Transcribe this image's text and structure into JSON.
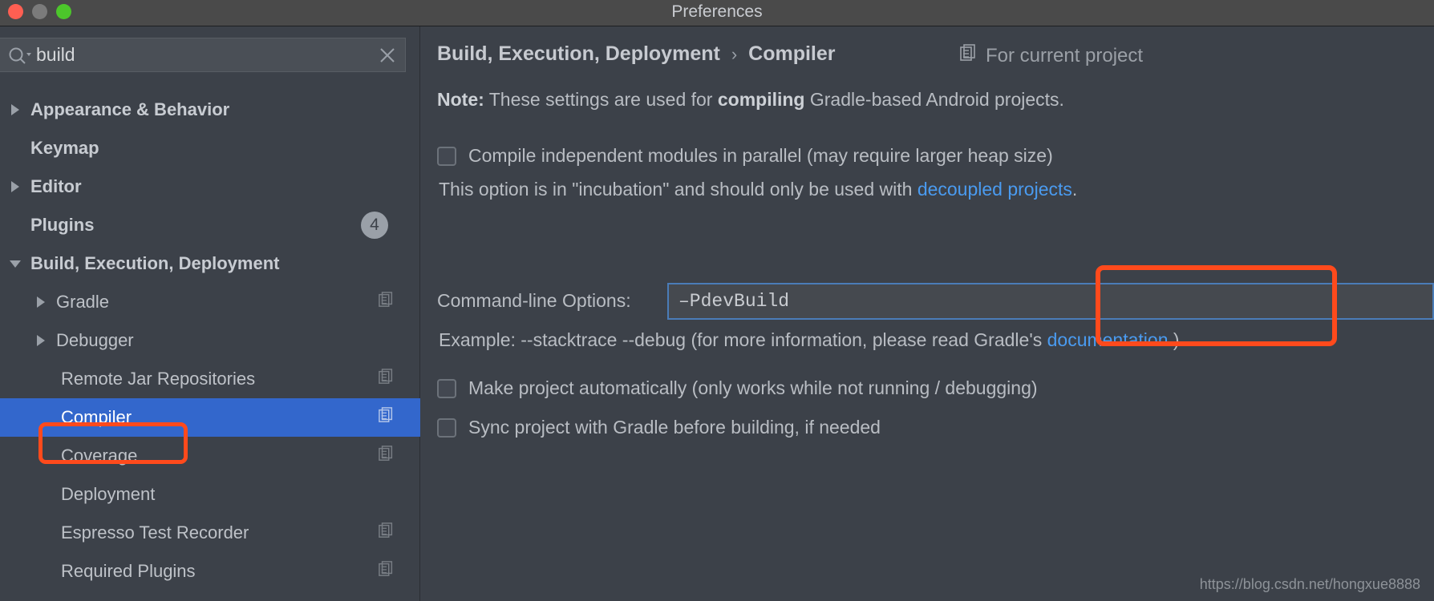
{
  "window": {
    "title": "Preferences",
    "traffic_lights": [
      "close-red",
      "minimize-gray",
      "zoom-green"
    ]
  },
  "search": {
    "value": "build",
    "placeholder": "",
    "icon": "search-icon",
    "clear_icon": "close-icon"
  },
  "sidebar": {
    "items": [
      {
        "label": "Appearance & Behavior",
        "arrow": "collapsed",
        "indent": 1,
        "bold": true,
        "badge": null,
        "copy": false,
        "selected": false
      },
      {
        "label": "Keymap",
        "arrow": "none",
        "indent": 1,
        "bold": true,
        "badge": null,
        "copy": false,
        "selected": false
      },
      {
        "label": "Editor",
        "arrow": "collapsed",
        "indent": 1,
        "bold": true,
        "badge": null,
        "copy": false,
        "selected": false
      },
      {
        "label": "Plugins",
        "arrow": "none",
        "indent": 1,
        "bold": true,
        "badge": "4",
        "copy": false,
        "selected": false
      },
      {
        "label": "Build, Execution, Deployment",
        "arrow": "expanded",
        "indent": 1,
        "bold": true,
        "badge": null,
        "copy": false,
        "selected": false
      },
      {
        "label": "Gradle",
        "arrow": "collapsed",
        "indent": 2,
        "bold": false,
        "badge": null,
        "copy": true,
        "selected": false
      },
      {
        "label": "Debugger",
        "arrow": "collapsed",
        "indent": 2,
        "bold": false,
        "badge": null,
        "copy": false,
        "selected": false
      },
      {
        "label": "Remote Jar Repositories",
        "arrow": "none",
        "indent": 2,
        "bold": false,
        "badge": null,
        "copy": true,
        "selected": false
      },
      {
        "label": "Compiler",
        "arrow": "none",
        "indent": 2,
        "bold": false,
        "badge": null,
        "copy": true,
        "selected": true
      },
      {
        "label": "Coverage",
        "arrow": "none",
        "indent": 2,
        "bold": false,
        "badge": null,
        "copy": true,
        "selected": false
      },
      {
        "label": "Deployment",
        "arrow": "none",
        "indent": 2,
        "bold": false,
        "badge": null,
        "copy": false,
        "selected": false
      },
      {
        "label": "Espresso Test Recorder",
        "arrow": "none",
        "indent": 2,
        "bold": false,
        "badge": null,
        "copy": true,
        "selected": false
      },
      {
        "label": "Required Plugins",
        "arrow": "none",
        "indent": 2,
        "bold": false,
        "badge": null,
        "copy": true,
        "selected": false
      }
    ]
  },
  "main": {
    "breadcrumb_parent": "Build, Execution, Deployment",
    "breadcrumb_sep": "›",
    "breadcrumb_current": "Compiler",
    "scope_label": "For current project",
    "scope_icon": "project-scope-icon",
    "note_prefix": "Note:",
    "note_text_1": " These settings are used for ",
    "note_bold": "compiling",
    "note_text_2": " Gradle-based Android projects.",
    "parallel_checkbox_label": "Compile independent modules in parallel (may require larger heap size)",
    "parallel_checked": false,
    "incubation_text_1": "This option is in \"incubation\" and should only be used with ",
    "incubation_link": "decoupled projects",
    "incubation_text_2": ".",
    "command_line_label": "Command-line Options:",
    "command_line_value": "–PdevBuild",
    "command_line_placeholder": "",
    "example_text_1": "Example: --stacktrace --debug (for more information, please read Gradle's ",
    "example_link": "documentation",
    "example_text_2": ".)",
    "make_project_label": "Make project automatically (only works while not running / debugging)",
    "make_project_checked": false,
    "sync_project_label": "Sync project with Gradle before building, if needed",
    "sync_project_checked": false
  },
  "watermark": "https://blog.csdn.net/hongxue8888",
  "colors": {
    "window_bg": "#3c4149",
    "titlebar_bg": "#4a4a4a",
    "selection_blue": "#3367cc",
    "link_blue": "#4a9bf0",
    "highlight_red": "#ff4a1c",
    "field_border_blue": "#4a7cb8"
  }
}
